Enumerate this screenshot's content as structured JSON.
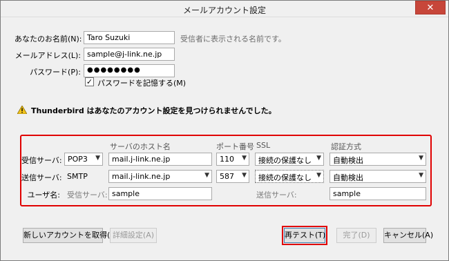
{
  "window": {
    "title": "メールアカウント設定",
    "close_glyph": "✕"
  },
  "identity": {
    "name_label": "あなたのお名前(N):",
    "name_value": "Taro Suzuki",
    "name_hint": "受信者に表示される名前です。",
    "email_label": "メールアドレス(L):",
    "email_value": "sample@j-link.ne.jp",
    "password_label": "パスワード(P):",
    "password_value": "●●●●●●●●",
    "remember_label": "パスワードを記憶する(M)",
    "remember_checked": true
  },
  "warning": {
    "icon": "warning-icon",
    "text": "Thunderbird はあなたのアカウント設定を見つけられませんでした。"
  },
  "server_table": {
    "headers": {
      "host": "サーバのホスト名",
      "port": "ポート番号",
      "ssl": "SSL",
      "auth": "認証方式"
    },
    "incoming": {
      "label": "受信サーバ:",
      "protocol": "POP3",
      "host": "mail.j-link.ne.jp",
      "port": "110",
      "ssl": "接続の保護なし",
      "auth": "自動検出"
    },
    "outgoing": {
      "label": "送信サーバ:",
      "protocol": "SMTP",
      "host": "mail.j-link.ne.jp",
      "port": "587",
      "ssl": "接続の保護なし",
      "auth": "自動検出"
    },
    "username": {
      "label": "ユーザ名:",
      "incoming_label": "受信サーバ:",
      "incoming_value": "sample",
      "outgoing_label": "送信サーバ:",
      "outgoing_value": "sample"
    },
    "highlight_color": "#e00000"
  },
  "buttons": {
    "new_account": "新しいアカウントを取得(G)",
    "advanced": "詳細設定(A)",
    "retest": "再テスト(T)",
    "done": "完了(D)",
    "cancel": "キャンセル(A)"
  }
}
